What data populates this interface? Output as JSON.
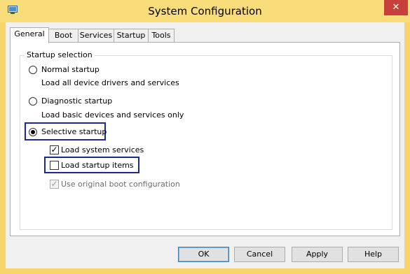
{
  "window": {
    "title": "System Configuration",
    "close_label": "✕",
    "app_icon": "msconfig-icon",
    "frame_color": "#f8d56b"
  },
  "tabs": [
    {
      "label": "General",
      "active": true
    },
    {
      "label": "Boot",
      "active": false
    },
    {
      "label": "Services",
      "active": false
    },
    {
      "label": "Startup",
      "active": false
    },
    {
      "label": "Tools",
      "active": false
    }
  ],
  "startup_selection": {
    "title": "Startup selection",
    "normal": {
      "label": "Normal startup",
      "description": "Load all device drivers and services",
      "selected": false
    },
    "diagnostic": {
      "label": "Diagnostic startup",
      "description": "Load basic devices and services only",
      "selected": false
    },
    "selective": {
      "label": "Selective startup",
      "selected": true
    },
    "load_system_services": {
      "label": "Load system services",
      "checked": true,
      "enabled": true
    },
    "load_startup_items": {
      "label": "Load startup items",
      "checked": false,
      "enabled": true
    },
    "use_original_boot": {
      "label": "Use original boot configuration",
      "checked": true,
      "enabled": false
    }
  },
  "buttons": {
    "ok": "OK",
    "cancel": "Cancel",
    "apply": "Apply",
    "help": "Help"
  },
  "highlight_color": "#1f2a8f"
}
